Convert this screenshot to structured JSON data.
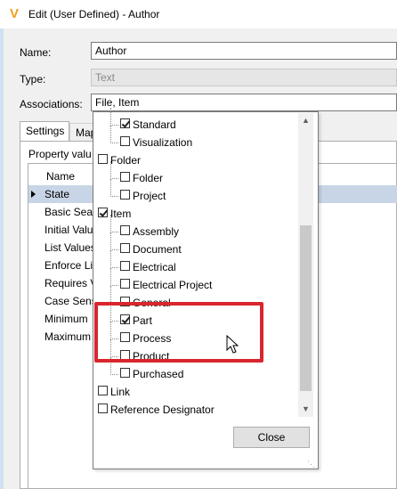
{
  "window": {
    "title": "Edit (User Defined) - Author",
    "app_icon": "vault-logo-icon",
    "accent": "#f0a020"
  },
  "form": {
    "name_label": "Name:",
    "name_value": "Author",
    "type_label": "Type:",
    "type_value": "Text",
    "associations_label": "Associations:",
    "associations_value": "File, Item"
  },
  "tabs": [
    {
      "label": "Settings",
      "active": true
    },
    {
      "label": "Map",
      "active": false
    }
  ],
  "property_values_label": "Property valu",
  "grid": {
    "header": "Name",
    "rows": [
      "State",
      "Basic Sear",
      "Initial Valu",
      "List Values",
      "Enforce Li",
      "Requires V",
      "Case Sens",
      "Minimum",
      "Maximum"
    ],
    "selected_row": "State"
  },
  "dropdown": {
    "items": [
      {
        "label": "Standard",
        "checked": true,
        "level": 1
      },
      {
        "label": "Visualization",
        "checked": false,
        "level": 1
      },
      {
        "label": "Folder",
        "checked": false,
        "level": 0
      },
      {
        "label": "Folder",
        "checked": false,
        "level": 1
      },
      {
        "label": "Project",
        "checked": false,
        "level": 1
      },
      {
        "label": "Item",
        "checked": true,
        "level": 0
      },
      {
        "label": "Assembly",
        "checked": false,
        "level": 1
      },
      {
        "label": "Document",
        "checked": false,
        "level": 1
      },
      {
        "label": "Electrical",
        "checked": false,
        "level": 1
      },
      {
        "label": "Electrical Project",
        "checked": false,
        "level": 1
      },
      {
        "label": "General",
        "checked": false,
        "level": 1
      },
      {
        "label": "Part",
        "checked": true,
        "level": 1
      },
      {
        "label": "Process",
        "checked": false,
        "level": 1
      },
      {
        "label": "Product",
        "checked": false,
        "level": 1
      },
      {
        "label": "Purchased",
        "checked": false,
        "level": 1
      },
      {
        "label": "Link",
        "checked": false,
        "level": 0
      },
      {
        "label": "Reference Designator",
        "checked": false,
        "level": 0
      }
    ],
    "close_label": "Close",
    "scroll_up_icon": "scroll-up-arrow-icon",
    "scroll_down_icon": "scroll-down-arrow-icon"
  },
  "highlight_color": "#d9262e"
}
